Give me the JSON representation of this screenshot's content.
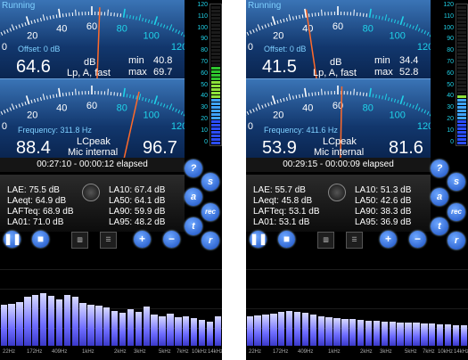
{
  "screens": [
    {
      "status": "Running",
      "meter1": {
        "scale_labels": [
          "0",
          "20",
          "40",
          "60",
          "80",
          "100",
          "120"
        ],
        "offset_label": "Offset: 0 dB",
        "value": "64.6",
        "unit": "dB",
        "mode": "Lp, A, fast",
        "min_label": "min",
        "min_value": "40.8",
        "max_label": "max",
        "max_value": "69.7",
        "needle_fraction": 0.54
      },
      "meter2": {
        "scale_labels": [
          "0",
          "20",
          "40",
          "60",
          "80",
          "100",
          "120"
        ],
        "frequency_label": "Frequency: 311.8 Hz",
        "value_left": "88.4",
        "mode": "LCpeak",
        "source": "Mic internal",
        "value_right": "96.7",
        "needle_fraction": 0.74
      },
      "elapsed": "00:27:10 - 00:00:12 elapsed",
      "stats": {
        "left": [
          "LAE: 75.5 dB",
          "LAeqt: 64.9 dB",
          "LAFTeq: 68.9 dB",
          "LA01: 71.0 dB"
        ],
        "right": [
          "LA10: 67.4 dB",
          "LA50: 64.1 dB",
          "LA90: 59.9 dB",
          "LA95: 48.2 dB"
        ]
      },
      "level_fraction": 0.56,
      "spectrum": [
        0.46,
        0.47,
        0.49,
        0.55,
        0.57,
        0.59,
        0.56,
        0.52,
        0.57,
        0.55,
        0.48,
        0.46,
        0.45,
        0.43,
        0.39,
        0.37,
        0.41,
        0.38,
        0.44,
        0.35,
        0.33,
        0.36,
        0.32,
        0.33,
        0.31,
        0.29,
        0.27,
        0.33
      ]
    },
    {
      "status": "Running",
      "meter1": {
        "scale_labels": [
          "0",
          "20",
          "40",
          "60",
          "80",
          "100",
          "120"
        ],
        "offset_label": "Offset: 0 dB",
        "value": "41.5",
        "unit": "dB",
        "mode": "Lp, A, fast",
        "min_label": "min",
        "min_value": "34.4",
        "max_label": "max",
        "max_value": "52.8",
        "needle_fraction": 0.34
      },
      "meter2": {
        "scale_labels": [
          "0",
          "20",
          "40",
          "60",
          "80",
          "100",
          "120"
        ],
        "frequency_label": "Frequency: 411.6 Hz",
        "value_left": "53.9",
        "mode": "LCpeak",
        "source": "Mic internal",
        "value_right": "81.6",
        "needle_fraction": 0.52
      },
      "elapsed": "00:29:15 - 00:00:09 elapsed",
      "stats": {
        "left": [
          "LAE: 55.7 dB",
          "LAeqt: 45.8 dB",
          "LAFTeq: 53.1 dB",
          "LA01: 53.1 dB"
        ],
        "right": [
          "LA10: 51.3 dB",
          "LA50: 42.6 dB",
          "LA90: 38.3 dB",
          "LA95: 36.9 dB"
        ]
      },
      "level_fraction": 0.35,
      "spectrum": [
        0.33,
        0.34,
        0.35,
        0.36,
        0.38,
        0.39,
        0.38,
        0.37,
        0.35,
        0.33,
        0.32,
        0.31,
        0.3,
        0.3,
        0.29,
        0.28,
        0.28,
        0.27,
        0.27,
        0.26,
        0.26,
        0.26,
        0.25,
        0.25,
        0.24,
        0.24,
        0.23,
        0.23
      ]
    }
  ],
  "side_buttons": [
    "?",
    "s",
    "a",
    "rec",
    "t",
    "r"
  ],
  "control_icons": [
    "pause-icon",
    "stop-icon",
    "spectrum-icon",
    "list-icon",
    "plus-icon",
    "minus-icon"
  ],
  "vbar_ticks": [
    "120",
    "110",
    "100",
    "90",
    "80",
    "70",
    "60",
    "50",
    "40",
    "30",
    "20",
    "10",
    "0"
  ],
  "freq_labels": [
    "22Hz",
    "172Hz",
    "409Hz",
    "1kHz",
    "2kHz",
    "3kHz",
    "5kHz",
    "7kHz",
    "10kHz",
    "14kHz"
  ],
  "colors": {
    "accent": "#1fd2e8",
    "needle": "#ff6a2a",
    "meter_top": "#3a74b6",
    "meter_bottom": "#0a2550",
    "spectrum": "#6e6cff"
  }
}
